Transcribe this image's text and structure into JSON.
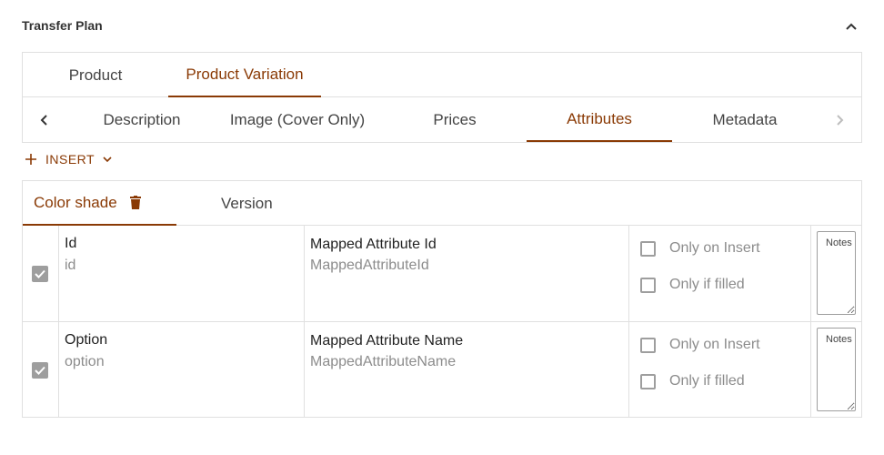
{
  "panel": {
    "title": "Transfer Plan",
    "collapse_icon": "chevron-up-icon"
  },
  "entity_tabs": [
    {
      "label": "Product",
      "active": false
    },
    {
      "label": "Product Variation",
      "active": true
    }
  ],
  "section_tabs": [
    {
      "label": "Description",
      "active": false
    },
    {
      "label": "Image (Cover Only)",
      "active": false
    },
    {
      "label": "Prices",
      "active": false
    },
    {
      "label": "Attributes",
      "active": true
    },
    {
      "label": "Metadata",
      "active": false
    }
  ],
  "insert": {
    "label": "INSERT",
    "plus_icon": "plus-icon",
    "dropdown_icon": "chevron-down-icon"
  },
  "attribute_tabs": [
    {
      "label": "Color shade",
      "active": true,
      "icon": "trash-icon"
    },
    {
      "label": "Version",
      "active": false
    }
  ],
  "rows": [
    {
      "checked": true,
      "field_label": "Id",
      "field_value": "id",
      "mapped_label": "Mapped Attribute Id",
      "mapped_value": "MappedAttributeId",
      "only_on_insert": "Only on Insert",
      "only_if_filled": "Only if filled",
      "notes_placeholder": "Notes"
    },
    {
      "checked": true,
      "field_label": "Option",
      "field_value": "option",
      "mapped_label": "Mapped Attribute Name",
      "mapped_value": "MappedAttributeName",
      "only_on_insert": "Only on Insert",
      "only_if_filled": "Only if filled",
      "notes_placeholder": "Notes"
    }
  ],
  "colors": {
    "accent": "#8a3a05",
    "border": "#e0e0e0",
    "muted_text": "#8c8c8c"
  }
}
